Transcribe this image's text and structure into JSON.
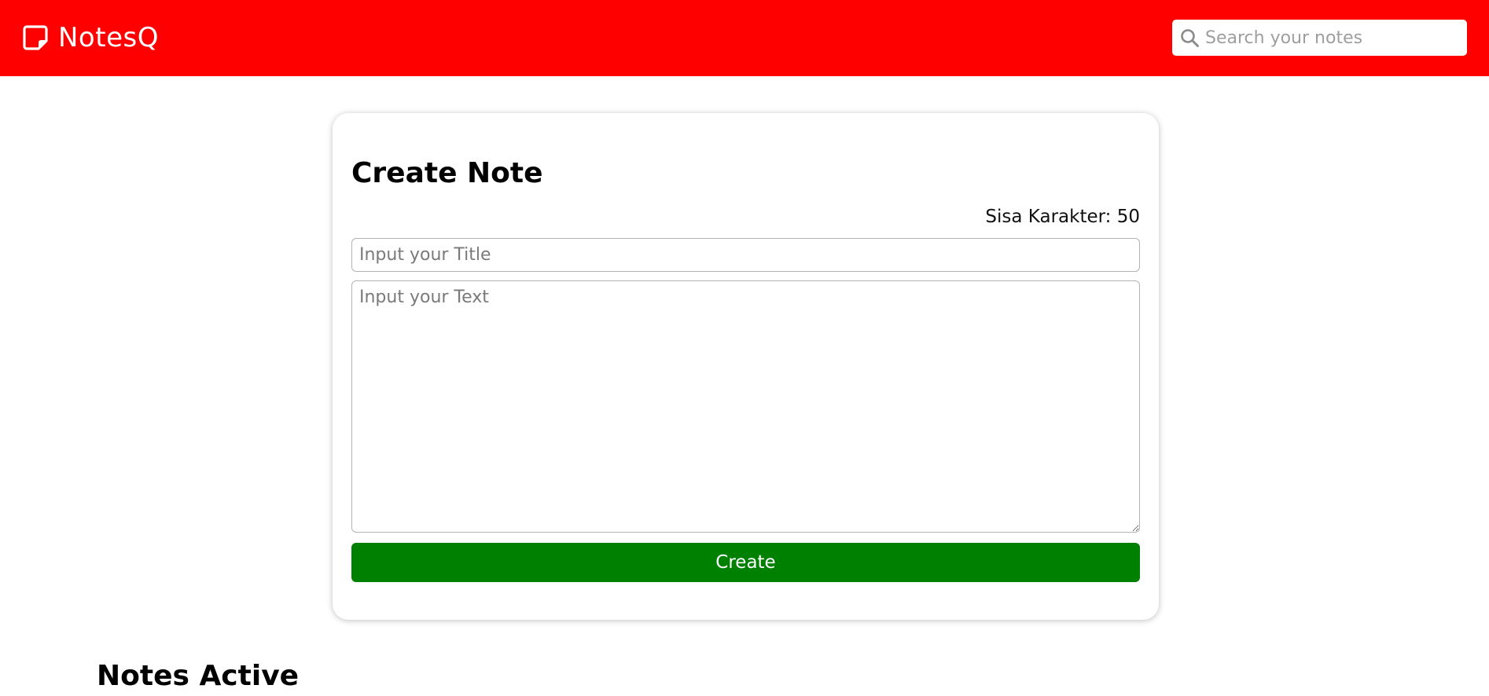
{
  "header": {
    "app_name": "NotesQ",
    "logo_icon": "sticky-note-icon",
    "background_color": "#ff0000",
    "search": {
      "icon": "search-icon",
      "placeholder": "Search your notes",
      "value": ""
    }
  },
  "create_note": {
    "title": "Create Note",
    "char_counter": "Sisa Karakter: 50",
    "title_input": {
      "placeholder": "Input your Title",
      "value": ""
    },
    "text_input": {
      "placeholder": "Input your Text",
      "value": ""
    },
    "submit_label": "Create",
    "submit_color": "#008000"
  },
  "notes_active": {
    "heading": "Notes Active"
  }
}
